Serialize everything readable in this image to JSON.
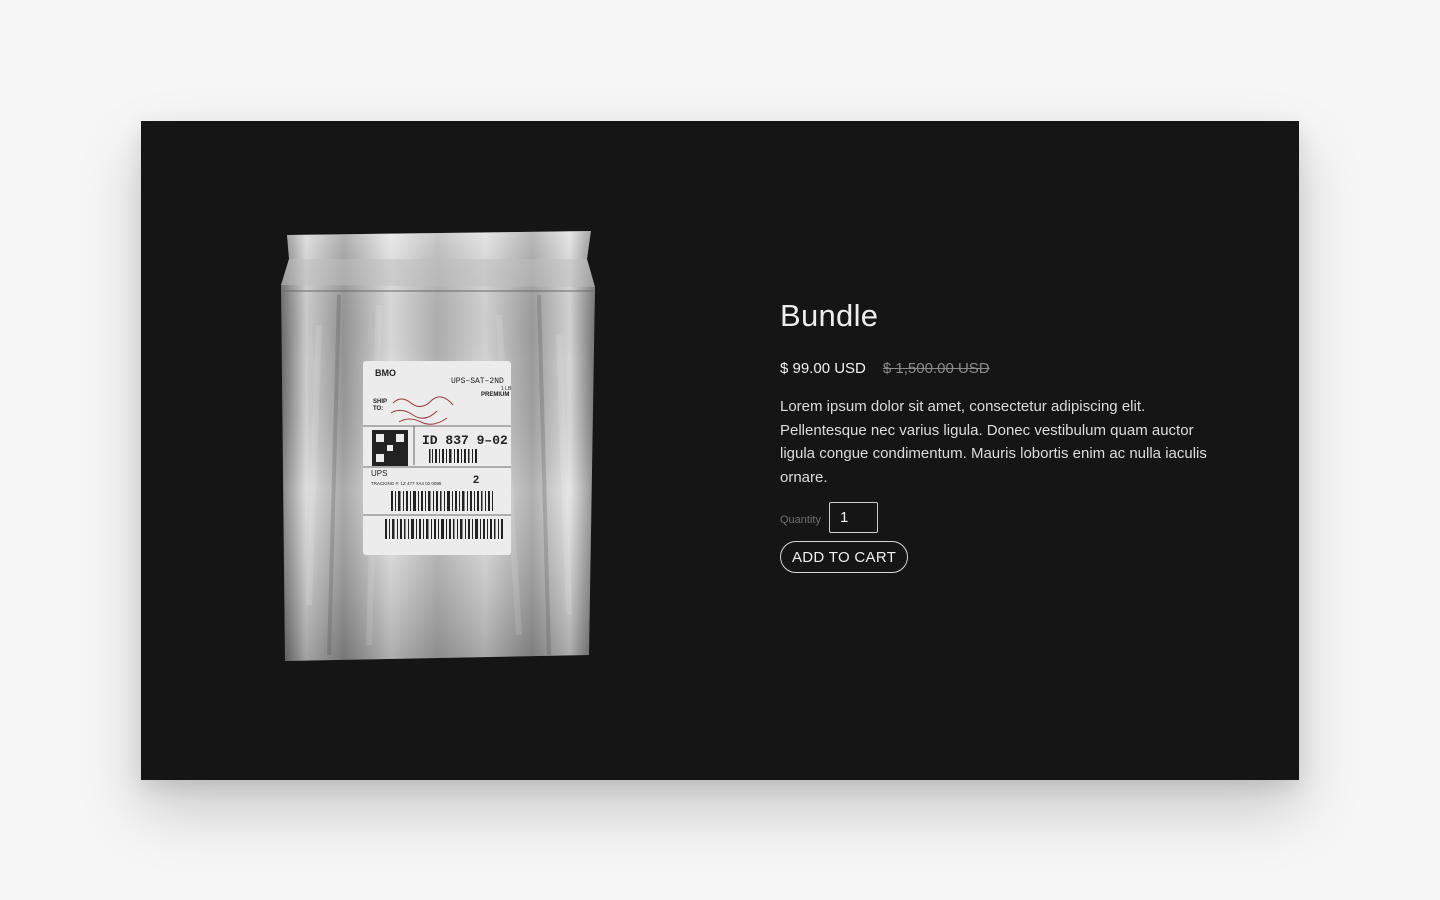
{
  "product": {
    "title": "Bundle",
    "price_current": "$ 99.00 USD",
    "price_original": "$ 1,500.00 USD",
    "description": "Lorem ipsum dolor sit amet, consectetur adipiscing elit. Pellentesque nec varius ligula. Donec vestibulum quam auctor ligula congue condimentum. Mauris lobortis enim ac nulla iaculis ornare.",
    "quantity_label": "Quantity",
    "quantity_value": "1",
    "add_to_cart_label": "ADD TO CART",
    "image_label": {
      "brand": "BMO",
      "service": "UPS–SAT–2ND",
      "weight": "1 LB",
      "tier": "PREMIUM",
      "ship_to": "SHIP\nTO:",
      "id": "ID 837 9–02",
      "carrier": "UPS",
      "count": "2",
      "tracking": "TRACKING #: 1Z 477 YA4 02 0095"
    }
  },
  "colors": {
    "page_background": "#f6f6f6",
    "card_background": "#151515",
    "text": "#ededed",
    "muted": "#8a8a8a"
  }
}
